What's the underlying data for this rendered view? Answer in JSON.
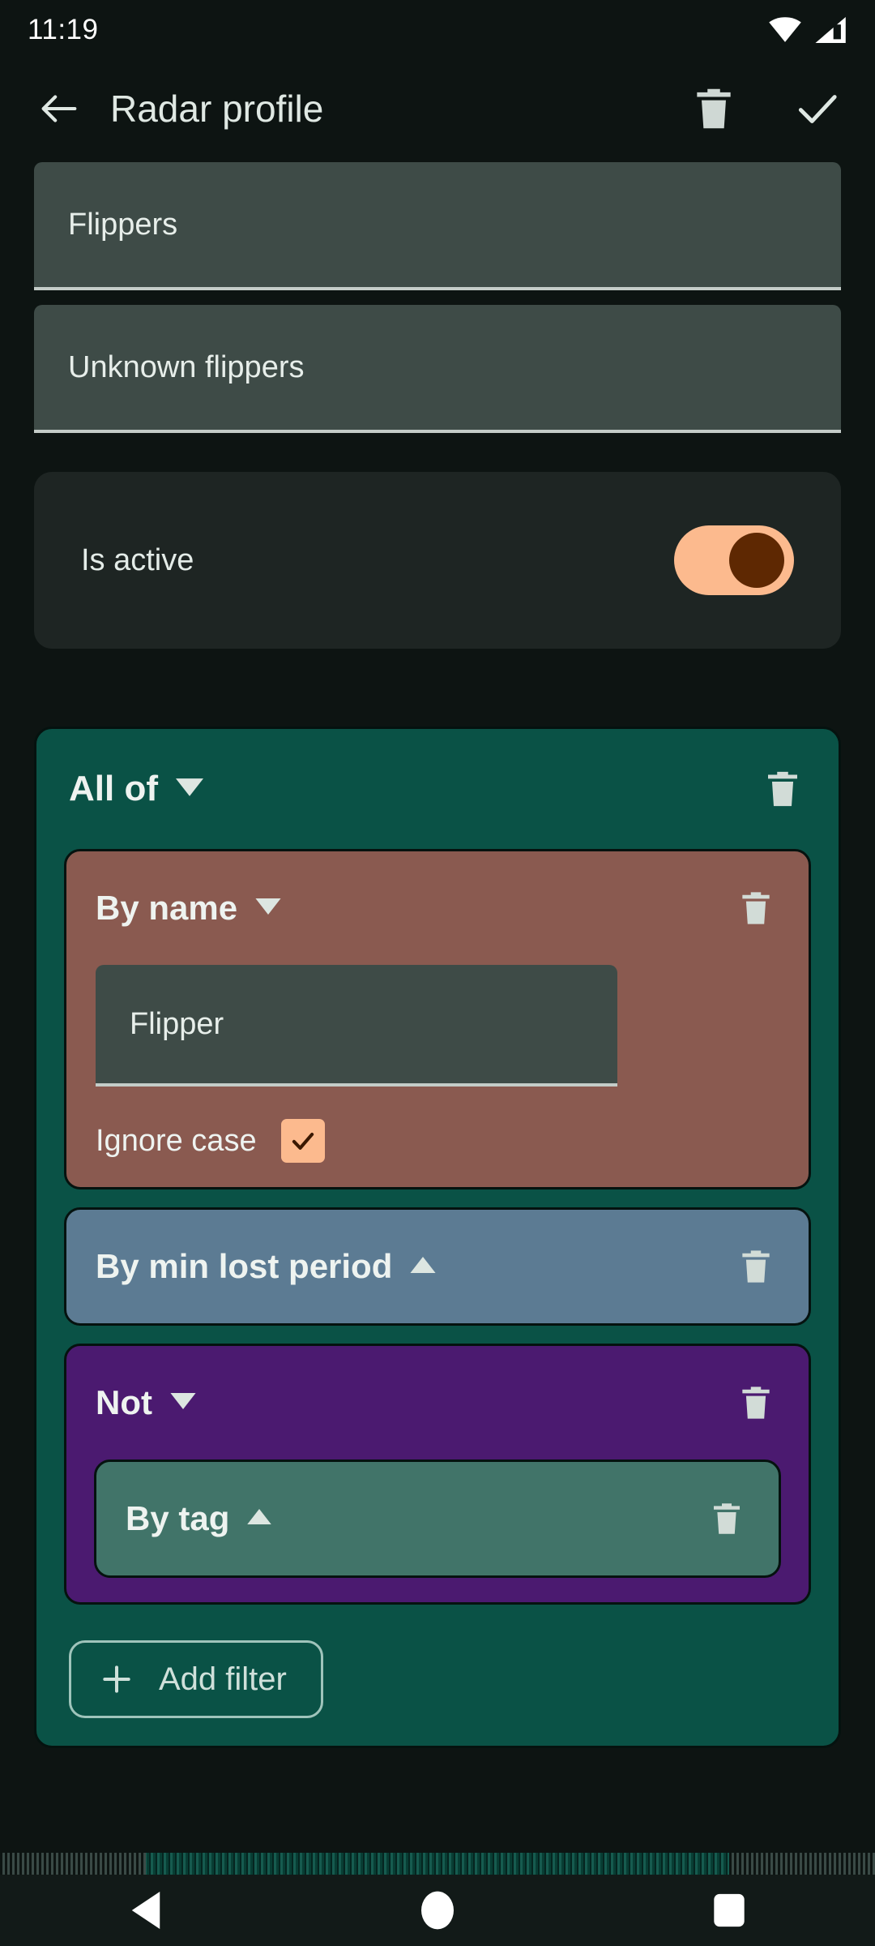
{
  "status_bar": {
    "clock": "11:19",
    "icons": [
      "wifi-icon",
      "cellular-signal-icon"
    ]
  },
  "app_bar": {
    "back_icon": "back-arrow-icon",
    "title": "Radar profile",
    "delete_icon": "trash-icon",
    "save_icon": "check-icon"
  },
  "form": {
    "name_field": {
      "value": "Flippers"
    },
    "description_field": {
      "value": "Unknown flippers"
    },
    "is_active": {
      "label": "Is active",
      "state": "on"
    }
  },
  "filter_tree": {
    "root": {
      "title": "All of",
      "chevron": "chevron-down-icon",
      "delete_icon": "trash-icon",
      "color": "#0a5246"
    },
    "children": [
      {
        "title": "By name",
        "chevron": "chevron-down-icon",
        "delete_icon": "trash-icon",
        "color": "#8a5a50",
        "value_field": {
          "value": "Flipper"
        },
        "ignore_case": {
          "label": "Ignore case",
          "checked": true
        }
      },
      {
        "title": "By min lost period",
        "chevron": "chevron-up-icon",
        "delete_icon": "trash-icon",
        "color": "#5c7b93"
      },
      {
        "title": "Not",
        "chevron": "chevron-down-icon",
        "delete_icon": "trash-icon",
        "color": "#4b1a70",
        "child": {
          "title": "By tag",
          "chevron": "chevron-up-icon",
          "delete_icon": "trash-icon",
          "color": "#417469"
        }
      }
    ],
    "add_filter": {
      "label": "Add filter",
      "icon": "plus-icon"
    }
  },
  "nav_bar": {
    "back": "nav-back-icon",
    "home": "nav-home-icon",
    "recents": "nav-recents-icon"
  },
  "colors": {
    "background": "#0d1412",
    "field_fill": "#3e4b47",
    "accent_peach": "#fcba8e",
    "accent_dark_brown": "#5e2802",
    "group_green": "#0a5246",
    "filter_brown": "#8a5a50",
    "filter_blue": "#5c7b93",
    "filter_purple": "#4b1a70",
    "filter_teal": "#417469",
    "on_surface": "#e7eeea"
  }
}
